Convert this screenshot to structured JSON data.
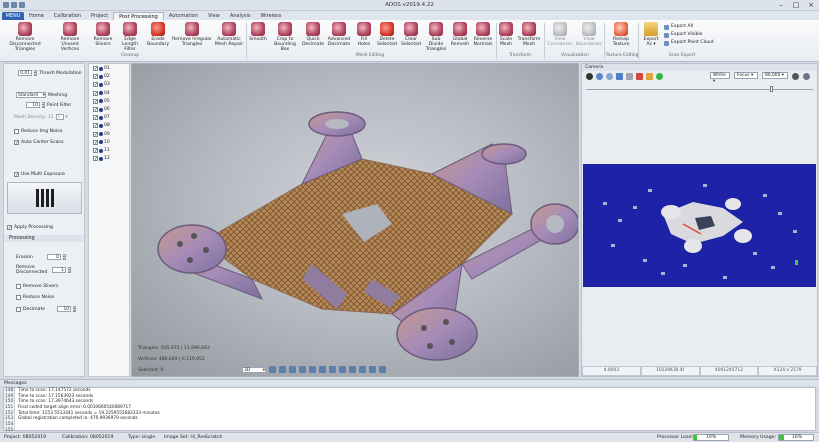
{
  "app": {
    "title": "ADOS v2019.4.22"
  },
  "tabs": [
    {
      "label": "MENU"
    },
    {
      "label": "Home"
    },
    {
      "label": "Calibration"
    },
    {
      "label": "Project"
    },
    {
      "label": "Post Processing"
    },
    {
      "label": "Automation"
    },
    {
      "label": "View"
    },
    {
      "label": "Analysis"
    },
    {
      "label": "Wireless"
    }
  ],
  "ribbon": {
    "buttons": [
      {
        "label": "Remove Disconnected Triangles"
      },
      {
        "label": "Remove Unused Vertices"
      },
      {
        "label": "Remove Slivers"
      },
      {
        "label": "Edge Length Filter"
      },
      {
        "label": "Erode Boundary"
      },
      {
        "label": "Remove Irregular Triangles"
      },
      {
        "label": "Automatic Mesh Repair"
      },
      {
        "label": "Smooth"
      },
      {
        "label": "Crop to Bounding Box"
      },
      {
        "label": "Quick Decimate"
      },
      {
        "label": "Advanced Decimate"
      },
      {
        "label": "Fill Holes"
      },
      {
        "label": "Delete Selected"
      },
      {
        "label": "Clear Selected"
      },
      {
        "label": "Sub Divide Triangles"
      },
      {
        "label": "Global Remesh"
      },
      {
        "label": "Reverse Normals"
      },
      {
        "label": "Scale Mesh"
      },
      {
        "label": "Transform Mesh"
      },
      {
        "label": "View Curvatures"
      },
      {
        "label": "View Boundaries"
      },
      {
        "label": "Remap Texture"
      },
      {
        "label": "Export As"
      }
    ],
    "export_items": [
      {
        "label": "Export All"
      },
      {
        "label": "Export Visible"
      },
      {
        "label": "Export Point Cloud"
      }
    ],
    "groups": [
      {
        "label": "Cleanup"
      },
      {
        "label": "Mesh Editing"
      },
      {
        "label": "Transform"
      },
      {
        "label": "Visualization"
      },
      {
        "label": "Texture Editing"
      },
      {
        "label": "Scan Export"
      }
    ]
  },
  "left": {
    "thresh_value": "0.01",
    "thresh_label": "Thresh Modulation",
    "mode_value": "Standard",
    "meshing_label": "Meshing",
    "point_filter_value": "10",
    "point_filter_label": "Point Filter",
    "mesh_density_label": "Mesh Density: 11",
    "mesh_density_value": "1",
    "reduce_img_noise": "Reduce Img Noise",
    "auto_center_scans": "Auto Center Scans",
    "use_multi_exposure": "Use Multi Exposure",
    "apply_processing": "Apply Processing",
    "processing_header": "Processing",
    "erosion_label": "Erosion",
    "erosion_value": "0",
    "remove_disconnected_label": "Remove Disconnected",
    "remove_disconnected_value": "1",
    "remove_slivers": "Remove Slivers",
    "reduce_noise": "Reduce Noise",
    "decimate_label": "Decimate",
    "decimate_value": "10"
  },
  "scans": [
    "01",
    "02",
    "03",
    "04",
    "05",
    "06",
    "07",
    "08",
    "09",
    "10",
    "11",
    "12"
  ],
  "viewport": {
    "triangles": "Triangles: 935,975  |  11,996,683",
    "vertices": "Vertices: 486,649  |  6,119,052",
    "selected": "Selected: 0",
    "view_mode": "3D"
  },
  "camera": {
    "header": "Camera",
    "color_value": "White",
    "focus_value": "Focus",
    "exposure_value": "80,000",
    "status": [
      "4.0003",
      "10229430.4f",
      "4001245713",
      "X124 x 2179"
    ]
  },
  "messages": {
    "header": "Messages",
    "line_numbers": [
      "148",
      "149",
      "150",
      "151",
      "152",
      "153",
      "154",
      "155"
    ],
    "lines": [
      "Time to scan: 17.147572 seconds",
      "Time to scan: 17.1563923 seconds",
      "Time to scan: 17.3974643 seconds",
      "Final coded target align error: 0.0010660540089717",
      "Total time: 1153.5513341 seconds = 19.2259555683333 minutes",
      "Global registration completed in: 470.9936979 seconds",
      "",
      ""
    ]
  },
  "statusbar": {
    "project": "Project: 08052019",
    "calibration": "Calibration: 08052019",
    "type": "Type: single",
    "image_set": "Image Set: Hi_Res",
    "scratch": "Scratch",
    "processor_label": "Processor Load:",
    "processor_value": "10%",
    "processor_fill": 0.1,
    "memory_label": "Memory Usage:",
    "memory_value": "16%",
    "memory_fill": 0.16
  }
}
